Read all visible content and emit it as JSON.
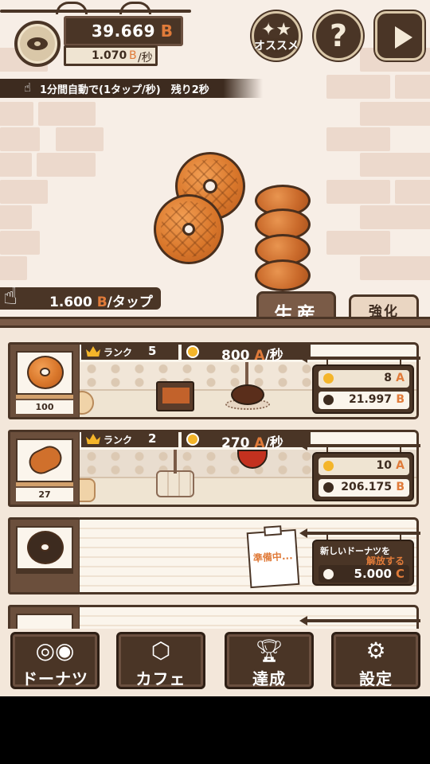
{
  "header": {
    "money_value": "39.669",
    "money_unit": "B",
    "rate_value": "1.070",
    "rate_unit": "B",
    "rate_per": "/秒"
  },
  "top_buttons": {
    "osusume_label": "オススメ",
    "help_glyph": "?"
  },
  "auto_banner": {
    "text": "1分間自動で(1タップ/秒)　残り2秒"
  },
  "tap": {
    "value": "1.600",
    "unit": "B",
    "suffix": "/タップ"
  },
  "tabs": {
    "production": "生産",
    "upgrade": "強化"
  },
  "rows": [
    {
      "count": "100",
      "rank_label": "ランク",
      "rank": "5",
      "rate": "800",
      "rate_unit": "A",
      "rate_suffix": "/秒",
      "upgrade_cost_a": "8",
      "upgrade_cost_a_unit": "A",
      "upgrade_cost_b": "21.997",
      "upgrade_cost_b_unit": "B"
    },
    {
      "count": "27",
      "rank_label": "ランク",
      "rank": "2",
      "rate": "270",
      "rate_unit": "A",
      "rate_suffix": "/秒",
      "upgrade_cost_a": "10",
      "upgrade_cost_a_unit": "A",
      "upgrade_cost_b": "206.175",
      "upgrade_cost_b_unit": "B"
    }
  ],
  "locked_row": {
    "memo": "準備中...",
    "sign_line1": "新しいドーナツを",
    "sign_line2": "解放する",
    "cost": "5.000",
    "cost_unit": "C"
  },
  "nav": {
    "donuts": "ドーナツ",
    "cafe": "カフェ",
    "achievements": "達成",
    "settings": "設定"
  },
  "colors": {
    "accent": "#e07b3a",
    "dark_brown": "#4a3526",
    "cream": "#fbf5ec"
  }
}
